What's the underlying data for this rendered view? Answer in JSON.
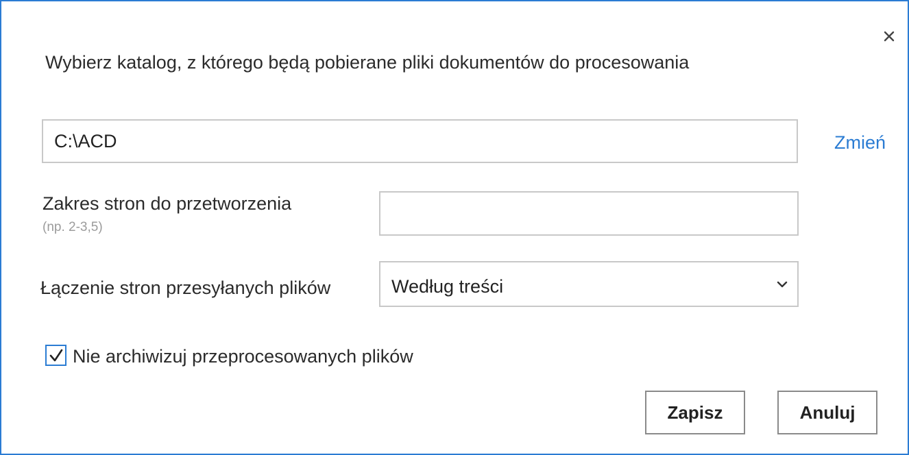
{
  "dialog": {
    "title": "Wybierz katalog, z którego będą pobierane pliki dokumentów do procesowania",
    "close_icon": "close-icon",
    "accent_color": "#2b7cd3"
  },
  "folder": {
    "path_value": "C:\\ACD",
    "change_link": "Zmień"
  },
  "page_range": {
    "label": "Zakres stron do przetworzenia",
    "hint": "(np. 2-3,5)",
    "value": ""
  },
  "page_merge": {
    "label": "Łączenie stron przesyłanych plików",
    "selected": "Według treści",
    "dropdown_icon": "chevron-down-icon"
  },
  "archive_option": {
    "label": "Nie archiwizuj przeprocesowanych plików",
    "checked": true
  },
  "buttons": {
    "save": "Zapisz",
    "cancel": "Anuluj"
  }
}
